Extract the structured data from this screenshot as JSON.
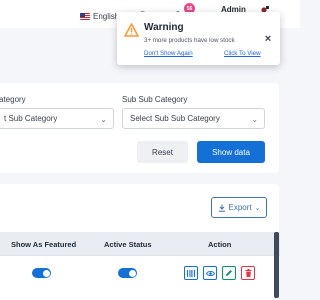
{
  "topbar": {
    "language": "English",
    "notification_count": "56",
    "admin_name": "Admin",
    "icons": [
      "flag-us-icon",
      "globe-icon",
      "store-icon",
      "cart-icon",
      "user-icon"
    ]
  },
  "warning": {
    "title": "Warning",
    "message": "3+ more products have low stock",
    "dont_show_again": "Don't Show Again",
    "click_to_view": "Click To View",
    "icon": "warning-triangle-icon"
  },
  "filters": {
    "sub_category_label": "ategory",
    "sub_category_placeholder": "t Sub Category",
    "sub_sub_category_label": "Sub Sub Category",
    "sub_sub_category_placeholder": "Select Sub Sub Category",
    "reset_label": "Reset",
    "show_data_label": "Show data"
  },
  "table": {
    "export_label": "Export",
    "columns": [
      "Show As Featured",
      "Active Status",
      "Action"
    ],
    "rows": [
      {
        "show_as_featured": true,
        "active_status": true
      }
    ]
  },
  "colors": {
    "primary": "#1570d6",
    "warning": "#f39c3a",
    "badge": "#e8488b",
    "danger": "#e3344c",
    "success": "#0e8f6e"
  }
}
